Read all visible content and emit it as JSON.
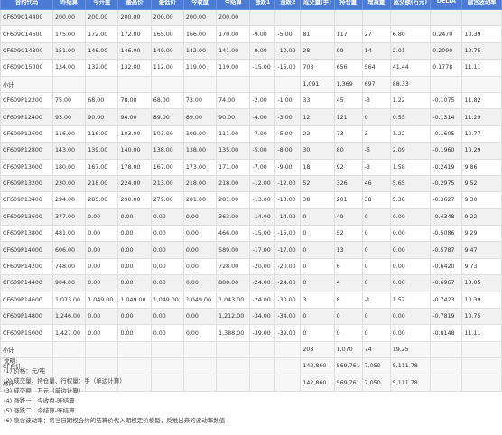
{
  "table": {
    "headers": [
      "合约代码",
      "昨结算",
      "今开盘",
      "最高价",
      "最低价",
      "今收盘",
      "今结算",
      "涨跌1",
      "涨跌2",
      "成交量(手)",
      "持仓量",
      "增减量",
      "成交额(万元)",
      "DELTA",
      "隐含波动率"
    ],
    "rows": [
      {
        "type": "data",
        "cells": [
          "CF609C14400",
          "200.00",
          "200.00",
          "200.00",
          "200.00",
          "200.00",
          "200.00",
          "",
          "",
          "",
          "",
          "",
          "",
          "",
          ""
        ]
      },
      {
        "type": "data",
        "cells": [
          "CF609C14600",
          "175.00",
          "172.00",
          "172.00",
          "165.00",
          "166.00",
          "170.00",
          "-9.00",
          "-5.00",
          "81",
          "117",
          "27",
          "6.80",
          "0.2470",
          "10.39"
        ]
      },
      {
        "type": "data",
        "cells": [
          "CF609C14800",
          "151.00",
          "146.00",
          "146.00",
          "140.00",
          "142.00",
          "141.00",
          "-9.00",
          "-10.00",
          "28",
          "99",
          "14",
          "2.01",
          "0.2090",
          "10.75"
        ]
      },
      {
        "type": "data",
        "cells": [
          "CF609C15000",
          "134.00",
          "132.00",
          "132.00",
          "112.00",
          "119.00",
          "119.00",
          "-15.00",
          "-15.00",
          "703",
          "656",
          "564",
          "41.44",
          "0.1778",
          "11.11"
        ]
      },
      {
        "type": "sub",
        "cells": [
          "小计",
          "",
          "",
          "",
          "",
          "",
          "",
          "",
          "",
          "1,091",
          "1,369",
          "697",
          "88.33",
          "",
          ""
        ]
      },
      {
        "type": "data",
        "cells": [
          "CF609P12200",
          "75.00",
          "68.00",
          "78.00",
          "68.00",
          "73.00",
          "74.00",
          "-2.00",
          "-1.00",
          "33",
          "45",
          "-3",
          "1.22",
          "-0.1075",
          "11.82"
        ]
      },
      {
        "type": "data",
        "cells": [
          "CF609P12400",
          "93.00",
          "90.00",
          "94.00",
          "89.00",
          "89.00",
          "90.00",
          "-4.00",
          "-3.00",
          "12",
          "121",
          "0",
          "0.55",
          "-0.1314",
          "11.29"
        ]
      },
      {
        "type": "data",
        "cells": [
          "CF609P12600",
          "116.00",
          "116.00",
          "103.00",
          "103.00",
          "109.00",
          "111.00",
          "-7.00",
          "-5.00",
          "22",
          "73",
          "3",
          "1.22",
          "-0.1605",
          "10.77"
        ]
      },
      {
        "type": "data",
        "cells": [
          "CF609P12800",
          "143.00",
          "139.00",
          "140.00",
          "138.00",
          "138.00",
          "135.00",
          "-5.00",
          "-8.00",
          "30",
          "80",
          "-6",
          "2.09",
          "-0.1960",
          "10.29"
        ]
      },
      {
        "type": "data",
        "cells": [
          "CF609P13000",
          "180.00",
          "167.00",
          "178.00",
          "167.00",
          "173.00",
          "171.00",
          "-7.00",
          "-9.00",
          "18",
          "92",
          "-3",
          "1.58",
          "-0.2419",
          "9.86"
        ]
      },
      {
        "type": "data",
        "cells": [
          "CF609P13200",
          "230.00",
          "218.00",
          "224.00",
          "213.00",
          "218.00",
          "218.00",
          "-12.00",
          "-12.00",
          "52",
          "326",
          "46",
          "5.65",
          "-0.2975",
          "9.52"
        ]
      },
      {
        "type": "data",
        "cells": [
          "CF609P13400",
          "294.00",
          "285.00",
          "290.00",
          "279.00",
          "281.00",
          "281.00",
          "-13.00",
          "-13.00",
          "38",
          "201",
          "38",
          "5.38",
          "-0.3627",
          "9.30"
        ]
      },
      {
        "type": "data",
        "cells": [
          "CF609P13600",
          "377.00",
          "0.00",
          "0.00",
          "0.00",
          "0.00",
          "363.00",
          "-14.00",
          "-14.00",
          "0",
          "49",
          "0",
          "0.00",
          "-0.4348",
          "9.22"
        ]
      },
      {
        "type": "data",
        "cells": [
          "CF609P13800",
          "481.00",
          "0.00",
          "0.00",
          "0.00",
          "0.00",
          "466.00",
          "-15.00",
          "-15.00",
          "0",
          "52",
          "0",
          "0.00",
          "-0.5086",
          "9.29"
        ]
      },
      {
        "type": "data",
        "cells": [
          "CF609P14000",
          "606.00",
          "0.00",
          "0.00",
          "0.00",
          "0.00",
          "589.00",
          "-17.00",
          "-17.00",
          "0",
          "13",
          "0",
          "0.00",
          "-0.5787",
          "9.47"
        ]
      },
      {
        "type": "data",
        "cells": [
          "CF609P14200",
          "748.00",
          "0.00",
          "0.00",
          "0.00",
          "0.00",
          "728.00",
          "-20.00",
          "-20.00",
          "0",
          "6",
          "0",
          "0.00",
          "-0.6420",
          "9.73"
        ]
      },
      {
        "type": "data",
        "cells": [
          "CF609P14400",
          "904.00",
          "0.00",
          "0.00",
          "0.00",
          "0.00",
          "880.00",
          "-24.00",
          "-24.00",
          "0",
          "4",
          "0",
          "0.00",
          "-0.6967",
          "10.05"
        ]
      },
      {
        "type": "data",
        "cells": [
          "CF609P14600",
          "1,073.00",
          "1,049.00",
          "1,049.00",
          "1,049.00",
          "1,049.00",
          "1,043.00",
          "-24.00",
          "-30.00",
          "3",
          "8",
          "-1",
          "1.57",
          "-0.7423",
          "10.39"
        ]
      },
      {
        "type": "data",
        "cells": [
          "CF609P14800",
          "1,246.00",
          "0.00",
          "0.00",
          "0.00",
          "0.00",
          "1,212.00",
          "-34.00",
          "-34.00",
          "0",
          "0",
          "0",
          "0.00",
          "-0.7819",
          "10.75"
        ]
      },
      {
        "type": "data",
        "cells": [
          "CF609P15000",
          "1,427.00",
          "0.00",
          "0.00",
          "0.00",
          "0.00",
          "1,388.00",
          "-39.00",
          "-39.00",
          "0",
          "0",
          "0",
          "0.00",
          "-0.8148",
          "11.11"
        ]
      },
      {
        "type": "sub",
        "cells": [
          "小计",
          "",
          "",
          "",
          "",
          "",
          "",
          "",
          "",
          "208",
          "1,070",
          "74",
          "19.25",
          "",
          ""
        ]
      },
      {
        "type": "sub",
        "cells": [
          "CF合计",
          "",
          "",
          "",
          "",
          "",
          "",
          "",
          "",
          "142,860",
          "569,761",
          "7,050",
          "5,111.78",
          "",
          ""
        ]
      },
      {
        "type": "sub",
        "cells": [
          "总计",
          "",
          "",
          "",
          "",
          "",
          "",
          "",
          "",
          "142,860",
          "569,761",
          "7,050",
          "5,111.78",
          "",
          ""
        ]
      }
    ]
  },
  "notes": {
    "title": "说明:",
    "lines": [
      "(1) 价格：元/吨",
      "(2) 成交量、持仓量、行权量：手（单边计算）",
      "(3) 成交额：万元（单边计算）",
      "(4) 涨跌一：今收盘-昨结算",
      "(5) 涨跌二：今结算-昨结算",
      "(6) 隐含波动率：将当日期权合约的结算价代入期权定价模型，反推出来的波动率数值"
    ]
  }
}
